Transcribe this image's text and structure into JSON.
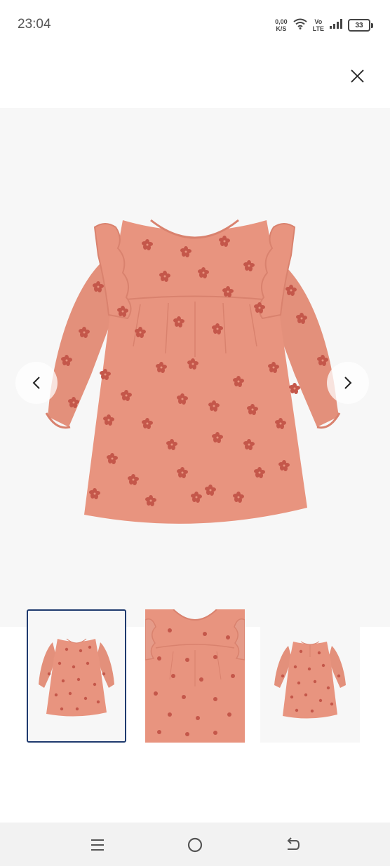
{
  "status_bar": {
    "time": "23:04",
    "net_speed_value": "0,00",
    "net_speed_unit": "K/S",
    "volte_top": "Vo",
    "volte_bottom": "LTE",
    "battery_level": "33"
  },
  "viewer": {
    "close_icon": "close-icon",
    "prev_icon": "chevron-left-icon",
    "next_icon": "chevron-right-icon",
    "selected_thumbnail_index": 0,
    "thumbnails": [
      {
        "view": "front"
      },
      {
        "view": "fabric-detail"
      },
      {
        "view": "back"
      }
    ]
  },
  "nav_bar": {
    "menu_icon": "menu-icon",
    "home_icon": "home-icon",
    "back_icon": "back-icon"
  },
  "colors": {
    "dress": "#e8947f",
    "dress_shade": "#d9826e",
    "flower": "#c4574a",
    "selected_border": "#1f3a6e",
    "nav_bar_bg": "#f2f2f2"
  }
}
